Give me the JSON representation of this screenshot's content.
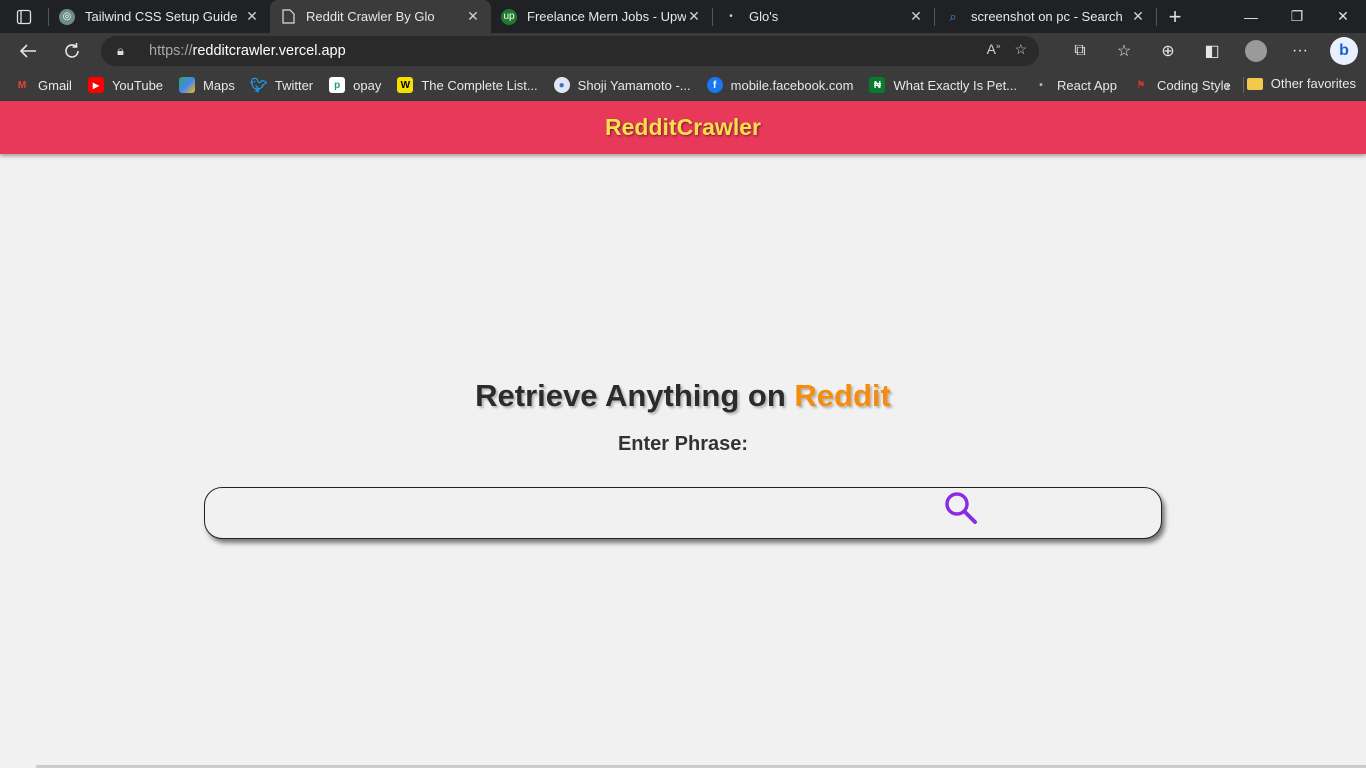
{
  "browser": {
    "tabs": [
      {
        "title": "Tailwind CSS Setup Guide",
        "active": false
      },
      {
        "title": "Reddit Crawler By Glo",
        "active": true
      },
      {
        "title": "Freelance Mern Jobs - Upwork",
        "active": false
      },
      {
        "title": "Glo's",
        "active": false
      },
      {
        "title": "screenshot on pc - Search",
        "active": false
      }
    ],
    "address": {
      "protocol": "https://",
      "host": "redditcrawler.vercel.app"
    },
    "bookmarks": [
      {
        "label": "Gmail",
        "icon": "gmail-icon"
      },
      {
        "label": "YouTube",
        "icon": "youtube-icon"
      },
      {
        "label": "Maps",
        "icon": "maps-icon"
      },
      {
        "label": "Twitter",
        "icon": "twitter-icon"
      },
      {
        "label": "opay",
        "icon": "opay-icon"
      },
      {
        "label": "The Complete List...",
        "icon": "w-icon"
      },
      {
        "label": "Shoji Yamamoto -...",
        "icon": "shoji-icon"
      },
      {
        "label": "mobile.facebook.com",
        "icon": "facebook-icon"
      },
      {
        "label": "What Exactly Is Pet...",
        "icon": "naira-icon"
      },
      {
        "label": "React App",
        "icon": "react-icon"
      },
      {
        "label": "Coding Style",
        "icon": "coding-icon"
      }
    ],
    "other_favorites": "Other favorites"
  },
  "page": {
    "brand": "RedditCrawler",
    "heading_main": "Retrieve Anything on ",
    "heading_accent": "Reddit",
    "label": "Enter Phrase:",
    "search_value": "",
    "colors": {
      "header_bg": "#e8395a",
      "brand": "#f7e04b",
      "accent": "#f58c0e",
      "search_icon": "#8a2be2"
    }
  }
}
